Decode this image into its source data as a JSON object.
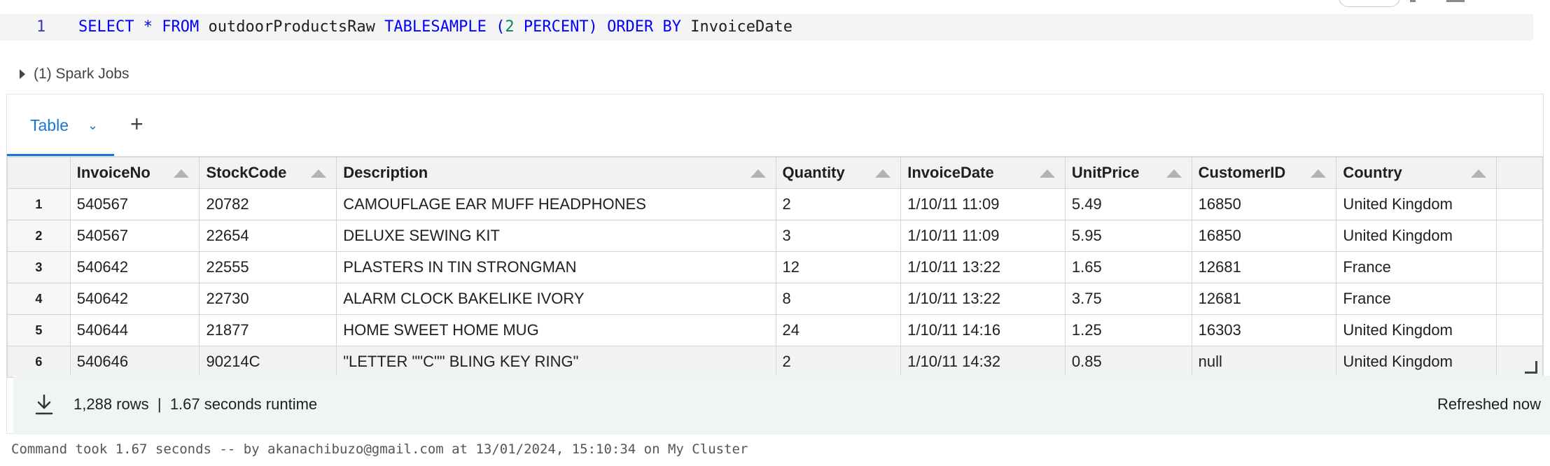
{
  "editor": {
    "line_number": "1",
    "tokens": {
      "select": "SELECT",
      "star": "*",
      "from": "FROM",
      "table": "outdoorProductsRaw",
      "tablesample": "TABLESAMPLE",
      "lparen": "(",
      "num": "2",
      "percent": "PERCENT)",
      "order": "ORDER",
      "by": "BY",
      "col": "InvoiceDate"
    }
  },
  "spark_jobs": "(1) Spark Jobs",
  "tabs": {
    "active": "Table",
    "chevron": "⌄",
    "add": "+"
  },
  "table": {
    "columns": [
      "InvoiceNo",
      "StockCode",
      "Description",
      "Quantity",
      "InvoiceDate",
      "UnitPrice",
      "CustomerID",
      "Country"
    ],
    "rows": [
      {
        "n": "1",
        "cells": [
          "540567",
          "20782",
          "CAMOUFLAGE EAR MUFF HEADPHONES",
          "2",
          "1/10/11 11:09",
          "5.49",
          "16850",
          "United Kingdom"
        ]
      },
      {
        "n": "2",
        "cells": [
          "540567",
          "22654",
          "DELUXE SEWING KIT",
          "3",
          "1/10/11 11:09",
          "5.95",
          "16850",
          "United Kingdom"
        ]
      },
      {
        "n": "3",
        "cells": [
          "540642",
          "22555",
          "PLASTERS IN TIN STRONGMAN",
          "12",
          "1/10/11 13:22",
          "1.65",
          "12681",
          "France"
        ]
      },
      {
        "n": "4",
        "cells": [
          "540642",
          "22730",
          "ALARM CLOCK BAKELIKE IVORY",
          "8",
          "1/10/11 13:22",
          "3.75",
          "12681",
          "France"
        ]
      },
      {
        "n": "5",
        "cells": [
          "540644",
          "21877",
          "HOME SWEET HOME MUG",
          "24",
          "1/10/11 14:16",
          "1.25",
          "16303",
          "United Kingdom"
        ]
      },
      {
        "n": "6",
        "cells": [
          "540646",
          "90214C",
          "\"LETTER \"\"C\"\" BLING KEY RING\"",
          "2",
          "1/10/11 14:32",
          "0.85",
          "null",
          "United Kingdom"
        ]
      }
    ]
  },
  "footer": {
    "rows": "1,288 rows",
    "separator": "|",
    "runtime": "1.67 seconds runtime",
    "refreshed": "Refreshed now"
  },
  "command_info": "Command took 1.67 seconds -- by akanachibuzo@gmail.com at 13/01/2024, 15:10:34 on My Cluster",
  "colors": {
    "keyword": "#0000ff",
    "number": "#098658",
    "accent": "#1976d2",
    "footer_bg": "#eef5f3"
  }
}
